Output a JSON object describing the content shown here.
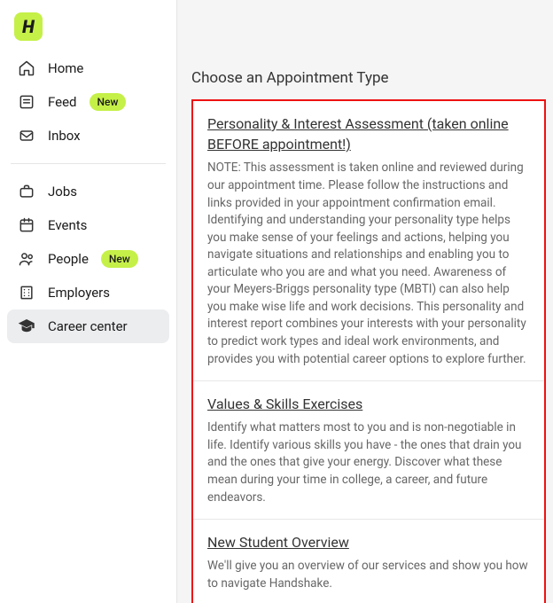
{
  "logo_letter": "H",
  "sidebar": {
    "primary": [
      {
        "label": "Home",
        "icon": "home",
        "badge": null
      },
      {
        "label": "Feed",
        "icon": "feed",
        "badge": "New"
      },
      {
        "label": "Inbox",
        "icon": "inbox",
        "badge": null
      }
    ],
    "secondary": [
      {
        "label": "Jobs",
        "icon": "jobs",
        "badge": null,
        "active": false
      },
      {
        "label": "Events",
        "icon": "events",
        "badge": null,
        "active": false
      },
      {
        "label": "People",
        "icon": "people",
        "badge": "New",
        "active": false
      },
      {
        "label": "Employers",
        "icon": "employers",
        "badge": null,
        "active": false
      },
      {
        "label": "Career center",
        "icon": "career",
        "badge": null,
        "active": true
      }
    ]
  },
  "main": {
    "section_title": "Choose an Appointment Type",
    "appointments": [
      {
        "title": "Personality & Interest Assessment (taken online BEFORE appointment!)",
        "desc": "NOTE: This assessment is taken online and reviewed during our appointment time. Please follow the instructions and links provided in your appointment confirmation email. Identifying and understanding your personality type helps you make sense of your feelings and actions, helping you navigate situations and relationships and enabling you to articulate who you are and what you need. Awareness of your Meyers-Briggs personality type (MBTI) can also help you make wise life and work decisions. This personality and interest report combines your interests with your personality to predict work types and ideal work environments, and provides you with potential career options to explore further."
      },
      {
        "title": "Values & Skills Exercises",
        "desc": "Identify what matters most to you and is non-negotiable in life. Identify various skills you have - the ones that drain you and the ones that give your energy. Discover what these mean during your time in college, a career, and future endeavors."
      },
      {
        "title": "New Student Overview",
        "desc": "We'll give you an overview of our services and show you how to navigate Handshake."
      }
    ]
  }
}
